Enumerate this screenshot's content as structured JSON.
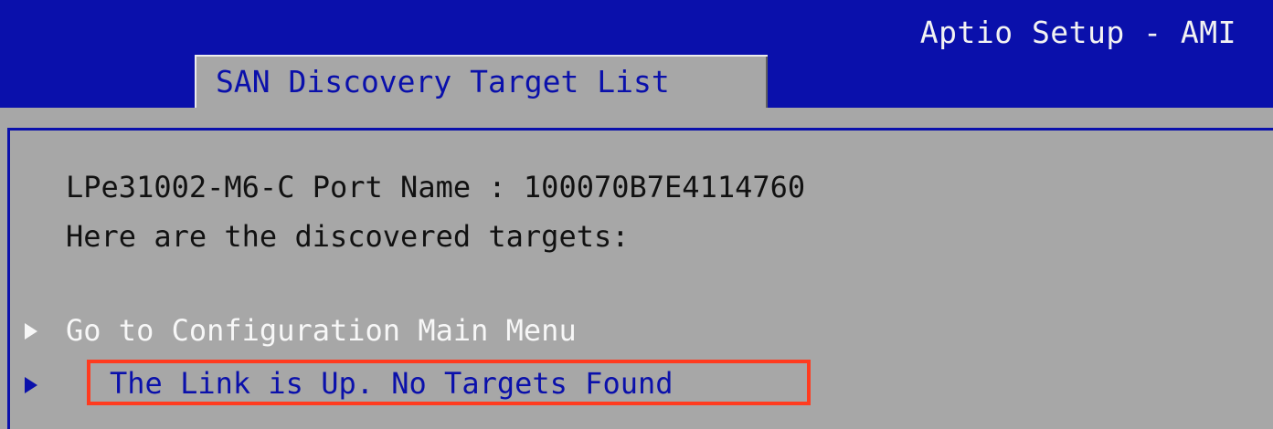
{
  "header": {
    "app_title": "Aptio Setup - AMI",
    "tab_title": "SAN Discovery Target List"
  },
  "content": {
    "port_line": "LPe31002-M6-C Port Name : 100070B7E4114760",
    "intro_line": "Here are the discovered targets:"
  },
  "menu": {
    "items": [
      {
        "label": "Go to Configuration Main Menu",
        "icon": "right-triangle-arrow-icon"
      },
      {
        "label": "The Link is Up. No Targets Found",
        "icon": "right-triangle-arrow-icon",
        "highlighted": true
      }
    ]
  },
  "colors": {
    "header_blue": "#0a10ab",
    "panel_gray": "#a7a7a7",
    "default_text": "#111111",
    "menu_white": "#f7f7f7",
    "selected_blue": "#0a10ab",
    "highlight_red": "#ff3b1f"
  }
}
